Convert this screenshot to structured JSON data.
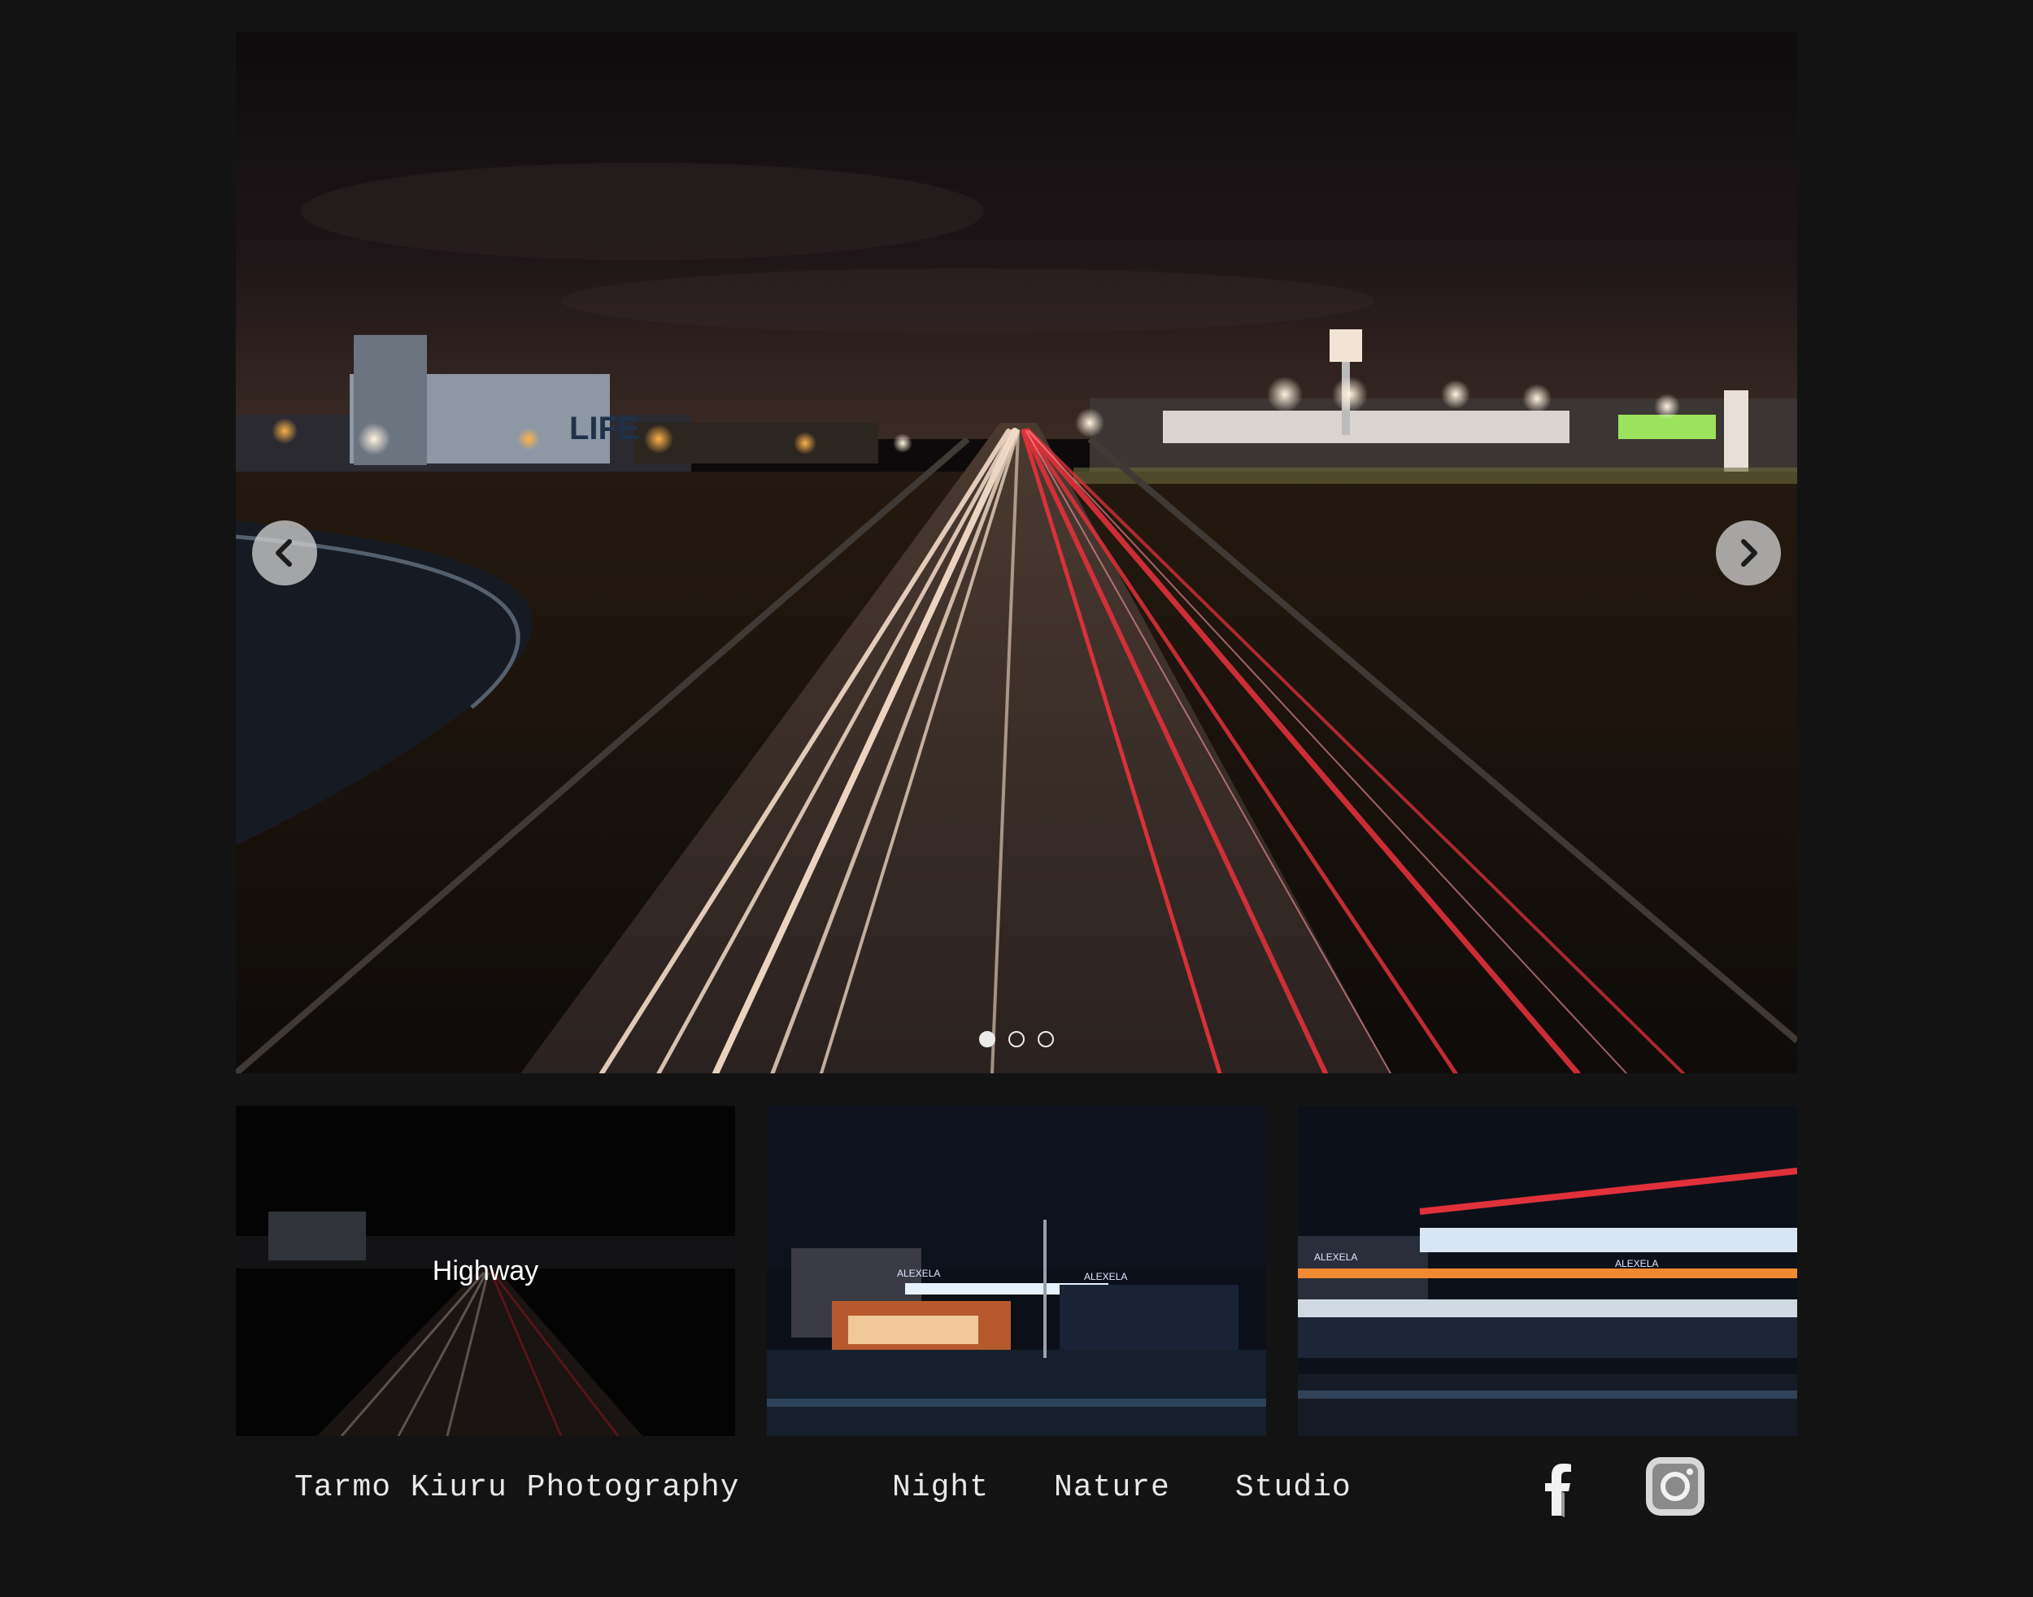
{
  "slider": {
    "prev_icon": "chevron-left-icon",
    "next_icon": "chevron-right-icon",
    "slide_count": 3,
    "active_index": 0,
    "sign_text": "LIFE"
  },
  "thumbnails": [
    {
      "caption": "Highway"
    },
    {
      "caption": "",
      "sign_left": "ALEXELA",
      "sign_right": "ALEXELA"
    },
    {
      "caption": "",
      "sign_left": "ALEXELA",
      "sign_right": "ALEXELA"
    }
  ],
  "footer": {
    "brand": "Tarmo Kiuru Photography",
    "nav": [
      "Night",
      "Nature",
      "Studio"
    ],
    "social": [
      "facebook-icon",
      "instagram-icon"
    ]
  },
  "colors": {
    "background": "#131313",
    "footer_text": "#e8e8e8",
    "tail_light": "#e0313a",
    "head_light": "#f4dcc8"
  }
}
